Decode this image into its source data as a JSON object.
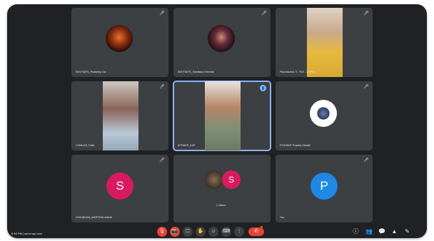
{
  "tiles": [
    {
      "name": "SMVTMITS_Pradheep Kar",
      "mic": "🎤︎"
    },
    {
      "name": "SMVTMITS_Samiksha Shemdk",
      "mic": "🎤︎"
    },
    {
      "name": "Paramkumar S - PLE - 3 AREA",
      "mic": "🎤︎"
    },
    {
      "name": "COMLIAS_Patki",
      "mic": "🎤︎"
    },
    {
      "name": "MTRADE_ASP",
      "mic": ""
    },
    {
      "name": "STUDENT Pramila Gandle",
      "mic": "🎤︎"
    },
    {
      "name": "VSHUBHAM_MARTPAD kolhati",
      "mic": "🎤︎",
      "letter": "S"
    },
    {
      "name": "2 others",
      "mic": "",
      "letter": "S"
    },
    {
      "name": "You",
      "mic": "🎤︎",
      "letter": "P"
    }
  ],
  "bottom": {
    "time": "8:45 PM | aaf-rmqu-vam",
    "controls": [
      "🎙",
      "📷",
      "⏍",
      "✋",
      "☺",
      "⌨",
      "⋮"
    ],
    "hangup": "✆",
    "right_icons": [
      "ⓘ",
      "👥",
      "💬",
      "▲",
      "✎"
    ]
  },
  "colors": {
    "background": "#202124",
    "tile": "#3c4043",
    "accent": "#8ab4f8",
    "red": "#ea4335",
    "avatar_s": "#d81b60",
    "avatar_p": "#1e88e5"
  }
}
